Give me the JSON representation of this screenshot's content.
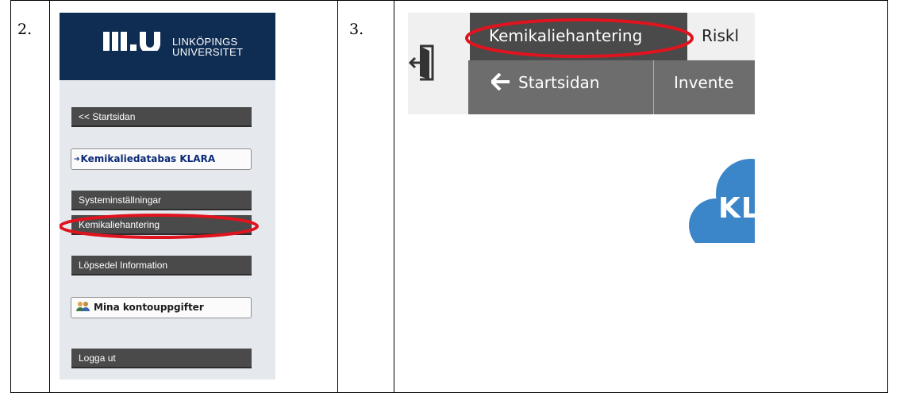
{
  "steps": [
    {
      "number": "2."
    },
    {
      "number": "3."
    }
  ],
  "liu": {
    "logo_word_top": "LINKÖPINGS",
    "logo_word_bottom": "UNIVERSITET"
  },
  "sidebar": {
    "startsidan": "<<  Startsidan",
    "klara_link": "Kemikaliedatabas KLARA",
    "systeminstallningar": "Systeminställningar",
    "kemikaliehantering": "Kemikaliehantering",
    "lopsedel": "Löpsedel Information",
    "mina_konto": "Mina kontouppgifter",
    "logga_ut": "Logga ut"
  },
  "klara_app": {
    "tab_active": "Kemikaliehantering",
    "tab_next": "Riskl",
    "nav_start": "Startsidan",
    "nav_invent": "Invente",
    "logo_text": "KL"
  },
  "colors": {
    "liu_navy": "#0f2d52",
    "sidebar_bg": "#e5e9ee",
    "button_dark": "#4a4a4a",
    "highlight_red": "#e0141f",
    "klara_blue": "#3b86c8"
  }
}
